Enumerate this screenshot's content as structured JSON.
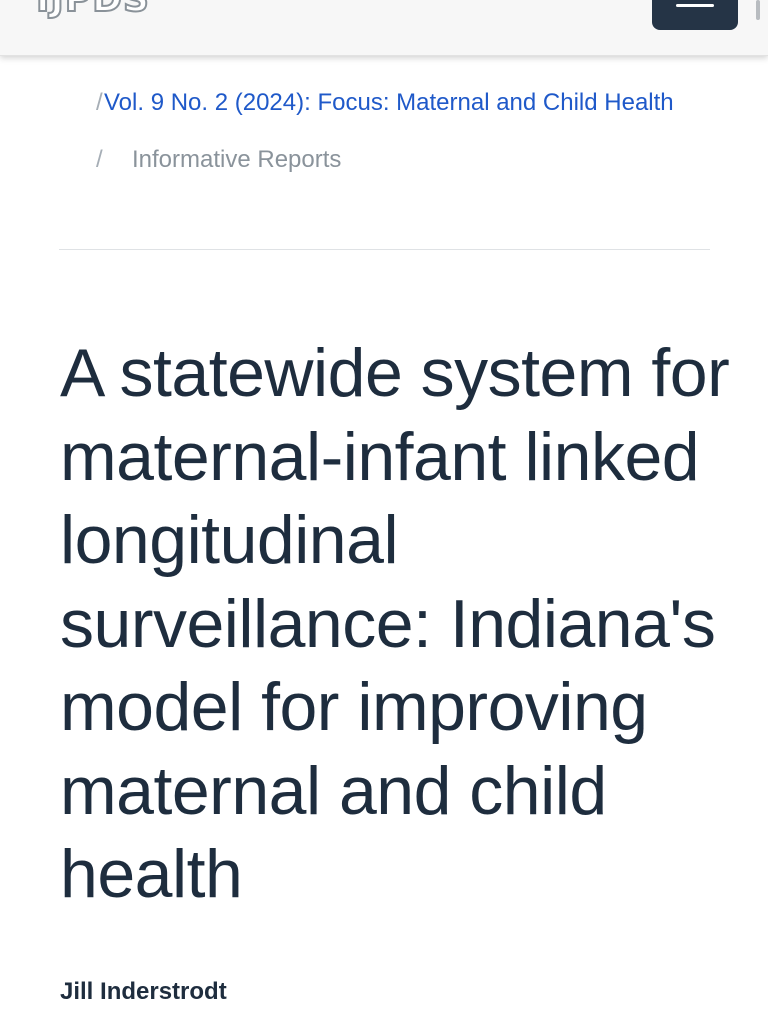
{
  "header": {
    "logo_text": "IJPDS",
    "menu_icon": "hamburger-menu-icon"
  },
  "breadcrumb": {
    "issue_link": "Vol. 9 No. 2 (2024): Focus: Maternal and Child Health",
    "section": "Informative Reports",
    "separator": "/"
  },
  "article": {
    "title": "A statewide system for maternal-infant linked longitudinal surveillance: Indiana's model for improving maternal and child health",
    "author": "Jill Inderstrodt"
  },
  "colors": {
    "link": "#1f59c9",
    "title": "#1e2d3e",
    "menu_button": "#253446"
  }
}
